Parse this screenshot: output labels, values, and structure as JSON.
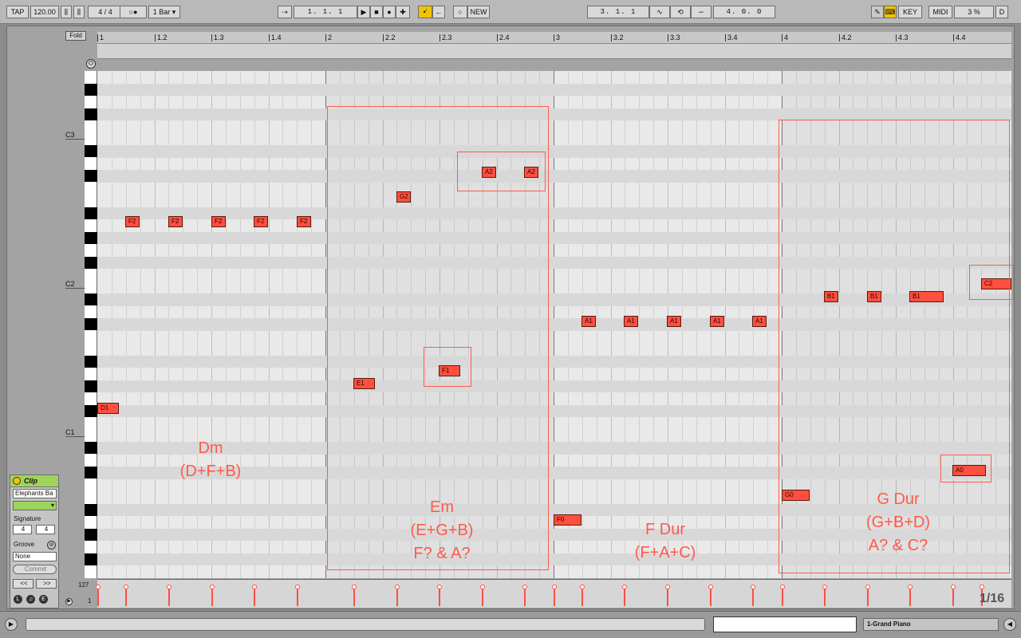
{
  "toolbar": {
    "tap": "TAP",
    "tempo": "120.00",
    "signature": "4 / 4",
    "metronome": "○●",
    "quantize": "1 Bar ▾",
    "arrangement_position": "1.   1.   1",
    "loop_start": "3.   1.   1",
    "loop_length": "4.   0.   0",
    "new": "NEW",
    "key": "KEY",
    "midi": "MIDI",
    "cpu": "3 %",
    "d": "D",
    "icons": [
      "follow-icon",
      "play-icon",
      "stop-icon",
      "record-icon",
      "overdub-icon",
      "automation-arm-icon",
      "back-to-arrangement-icon",
      "punch-in-icon",
      "loop-icon",
      "punch-out-icon",
      "draw-mode-icon",
      "computer-keyboard-icon"
    ],
    "accent": "#f2c300"
  },
  "editor": {
    "fold": "Fold",
    "ruler": [
      "1",
      "1.2",
      "1.3",
      "1.4",
      "2",
      "2.2",
      "2.3",
      "2.4",
      "3",
      "3.2",
      "3.3",
      "3.4",
      "4",
      "4.2",
      "4.3",
      "4.4"
    ],
    "octaves": [
      "C3",
      "C2",
      "C1"
    ],
    "grid_label": "1/16",
    "vel_top": "127",
    "vel_bottom": "1",
    "note_color": "#ff4f3f"
  },
  "notes": [
    {
      "label": "D1"
    },
    {
      "label": "F2"
    },
    {
      "label": "F2"
    },
    {
      "label": "F2"
    },
    {
      "label": "F2"
    },
    {
      "label": "F2"
    },
    {
      "label": "E1"
    },
    {
      "label": "G2"
    },
    {
      "label": "F1"
    },
    {
      "label": "A2"
    },
    {
      "label": "A2"
    },
    {
      "label": "F0"
    },
    {
      "label": "A1"
    },
    {
      "label": "A1"
    },
    {
      "label": "A1"
    },
    {
      "label": "A1"
    },
    {
      "label": "A1"
    },
    {
      "label": "G0"
    },
    {
      "label": "B1"
    },
    {
      "label": "B1"
    },
    {
      "label": "B1"
    },
    {
      "label": "A0"
    },
    {
      "label": "C2"
    }
  ],
  "annotations": {
    "dm": "Dm\n(D+F+B)",
    "em": "Em\n(E+G+B)\nF? & A?",
    "fdur": "F Dur\n(F+A+C)",
    "gdur": "G Dur\n(G+B+D)\nA? & C?",
    "color": "#ff5a4a"
  },
  "clip": {
    "title": "Clip",
    "name": "Elephants Ba",
    "color": "#9fd45a",
    "signature_label": "Signature",
    "sig_num": "4",
    "sig_den": "4",
    "groove_label": "Groove",
    "groove_value": "None",
    "commit": "Commit",
    "prev": "<<",
    "next": ">>"
  },
  "status": {
    "track": "1-Grand Piano"
  }
}
